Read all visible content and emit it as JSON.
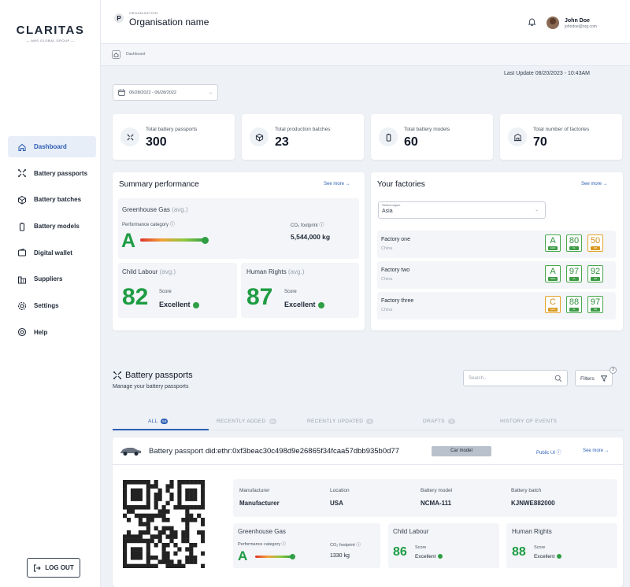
{
  "brand": {
    "name": "CLARITAS",
    "tagline": "— AMS GLOBAL GROUP —"
  },
  "sidebar": {
    "items": [
      {
        "label": "Dashboard",
        "icon": "home-icon",
        "active": true
      },
      {
        "label": "Battery passports",
        "icon": "passport-icon"
      },
      {
        "label": "Battery batches",
        "icon": "box-icon"
      },
      {
        "label": "Battery models",
        "icon": "battery-icon"
      },
      {
        "label": "Digital wallet",
        "icon": "wallet-icon"
      },
      {
        "label": "Suppliers",
        "icon": "building-icon"
      },
      {
        "label": "Settings",
        "icon": "gear-icon"
      },
      {
        "label": "Help",
        "icon": "help-icon"
      }
    ],
    "logout": "LOG OUT"
  },
  "header": {
    "org_label": "ORGANISATION",
    "org_name": "Organisation name",
    "user_name": "John Doe",
    "user_email": "johndoe@org.com"
  },
  "breadcrumb": "Dashboard",
  "last_update": "Last Update 08/20/2023 - 10:43AM",
  "date_range": "06/28/2022 - 06/28/2022",
  "stats": [
    {
      "label": "Total battery passports",
      "value": "300",
      "icon": "passport-icon"
    },
    {
      "label": "Total production batches",
      "value": "23",
      "icon": "box-icon"
    },
    {
      "label": "Total battery models",
      "value": "60",
      "icon": "battery-icon"
    },
    {
      "label": "Total number of factories",
      "value": "70",
      "icon": "factory-icon"
    }
  ],
  "summary": {
    "title": "Summary performance",
    "see_more": "See more →",
    "ghg_title": "Greenhouse Gas",
    "ghg_avg": "(avg.)",
    "perf_label": "Performance category ⓘ",
    "grade": "A",
    "co2_label": "CO₂ footprint ⓘ",
    "co2_value": "5,544,000 kg",
    "child_title": "Child Labour",
    "child_avg": "(avg.)",
    "child_score": "82",
    "child_score_label": "Score",
    "child_rating": "Excellent",
    "human_title": "Human Rights",
    "human_avg": "(avg.)",
    "human_score": "87",
    "human_score_label": "Score",
    "human_rating": "Excellent"
  },
  "factories": {
    "title": "Your factories",
    "see_more": "See more →",
    "region_label": "Select region",
    "region_value": "Asia",
    "rows": [
      {
        "name": "Factory one",
        "country": "China",
        "ghg": "A",
        "cl": "80",
        "hr": "50",
        "ghg_color": "green",
        "cl_color": "green",
        "hr_color": "orange"
      },
      {
        "name": "Factory two",
        "country": "China",
        "ghg": "A",
        "cl": "97",
        "hr": "92",
        "ghg_color": "green",
        "cl_color": "green",
        "hr_color": "green"
      },
      {
        "name": "Factory three",
        "country": "China",
        "ghg": "C",
        "cl": "88",
        "hr": "97",
        "ghg_color": "orange",
        "cl_color": "green",
        "hr_color": "green"
      }
    ],
    "badge_labels": {
      "ghg": "GHG",
      "cl": "CL",
      "hr": "HR"
    }
  },
  "passports": {
    "title": "Battery passports",
    "subtitle": "Manage your battery passports",
    "search_placeholder": "Search...",
    "filters": "Filters",
    "filters_count": "3",
    "tabs": [
      {
        "label": "ALL",
        "count": "99",
        "active": true
      },
      {
        "label": "RECENTLY ADDED",
        "count": "49"
      },
      {
        "label": "RECENTLY UPDATED",
        "count": "8"
      },
      {
        "label": "DRAFTS",
        "count": "3"
      },
      {
        "label": "HISTORY OF EVENTS",
        "count": ""
      }
    ],
    "card": {
      "title_prefix": "Battery passport",
      "did": "did:ethr:0xf3beac30c498d9e26865f34fcaa57dbb935b0d77",
      "chip": "Car model",
      "public_ui": "Public UI ⓘ",
      "see_more": "See more →",
      "manufacturer_label": "Manufacturer",
      "manufacturer": "Manufacturer",
      "location_label": "Location",
      "location": "USA",
      "model_label": "Battery model",
      "model": "NCMA-111",
      "batch_label": "Battery batch",
      "batch": "KJNWE882000",
      "ghg_title": "Greenhouse Gas",
      "perf_label": "Performance category ⓘ",
      "grade": "A",
      "co2_label": "CO₂ footprint ⓘ",
      "co2_value": "1330 kg",
      "child_title": "Child Labour",
      "child_score": "86",
      "child_score_label": "Score",
      "child_rating": "Excellent",
      "human_title": "Human Rights",
      "human_score": "88",
      "human_score_label": "Score",
      "human_rating": "Excellent"
    }
  },
  "colors": {
    "accent": "#2d5fb5",
    "good": "#2f9e44",
    "warn": "#e4a42c"
  }
}
